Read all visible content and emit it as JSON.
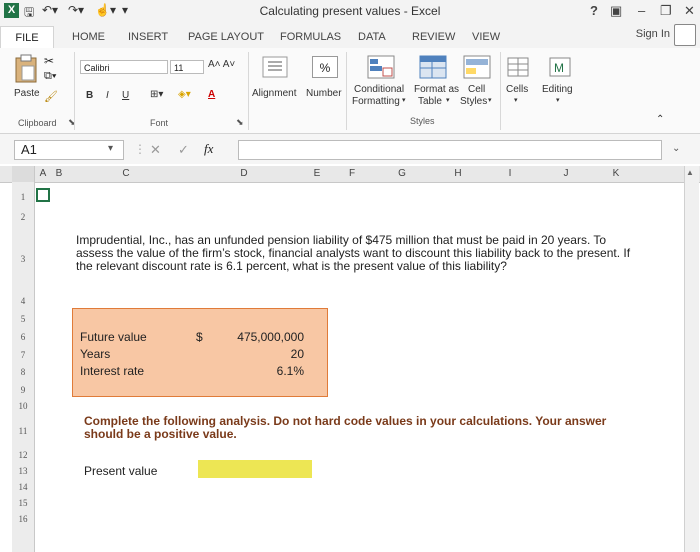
{
  "window": {
    "title": "Calculating present values - Excel",
    "help": "?",
    "minimize": "–",
    "restore": "❐",
    "close": "✕"
  },
  "tabs": [
    "FILE",
    "HOME",
    "INSERT",
    "PAGE LAYOUT",
    "FORMULAS",
    "DATA",
    "REVIEW",
    "VIEW"
  ],
  "sign_in": "Sign In",
  "ribbon": {
    "paste": "Paste",
    "clipboard": "Clipboard",
    "font_name": "Calibri",
    "font_size": "11",
    "bold": "B",
    "italic": "I",
    "underline": "U",
    "grow_font": "A˄ A˅",
    "font_color": "A",
    "font_group": "Font",
    "alignment": "Alignment",
    "number_symbol": "%",
    "number": "Number",
    "conditional": "Conditional",
    "formatting": "Formatting",
    "format_as": "Format as",
    "table": "Table",
    "cell": "Cell",
    "styles_btn": "Styles",
    "styles_group": "Styles",
    "cells": "Cells",
    "editing": "Editing"
  },
  "formula_bar": {
    "name_box": "A1",
    "cancel": "✕",
    "enter": "✓",
    "fx": "fx",
    "value": ""
  },
  "columns": [
    "A",
    "B",
    "C",
    "D",
    "E",
    "F",
    "G",
    "H",
    "I",
    "J",
    "K"
  ],
  "rows": [
    "1",
    "2",
    "3",
    "4",
    "5",
    "6",
    "7",
    "8",
    "9",
    "10",
    "11",
    "12",
    "13",
    "14",
    "15",
    "16"
  ],
  "sheet": {
    "question": "Imprudential, Inc., has an unfunded pension liability of $475 million that must be paid in 20 years. To assess the value of the firm’s stock, financial analysts want to discount this liability back to the present. If the relevant discount rate is 6.1 percent, what is the present value of this liability?",
    "inputs": [
      {
        "label": "Future value",
        "currency": "$",
        "value": "475,000,000"
      },
      {
        "label": "Years",
        "currency": "",
        "value": "20"
      },
      {
        "label": "Interest rate",
        "currency": "",
        "value": "6.1%"
      }
    ],
    "instruction": "Complete the following analysis. Do not hard code values in your calculations. Your answer should be a positive value.",
    "present_value_label": "Present value",
    "present_value": ""
  }
}
